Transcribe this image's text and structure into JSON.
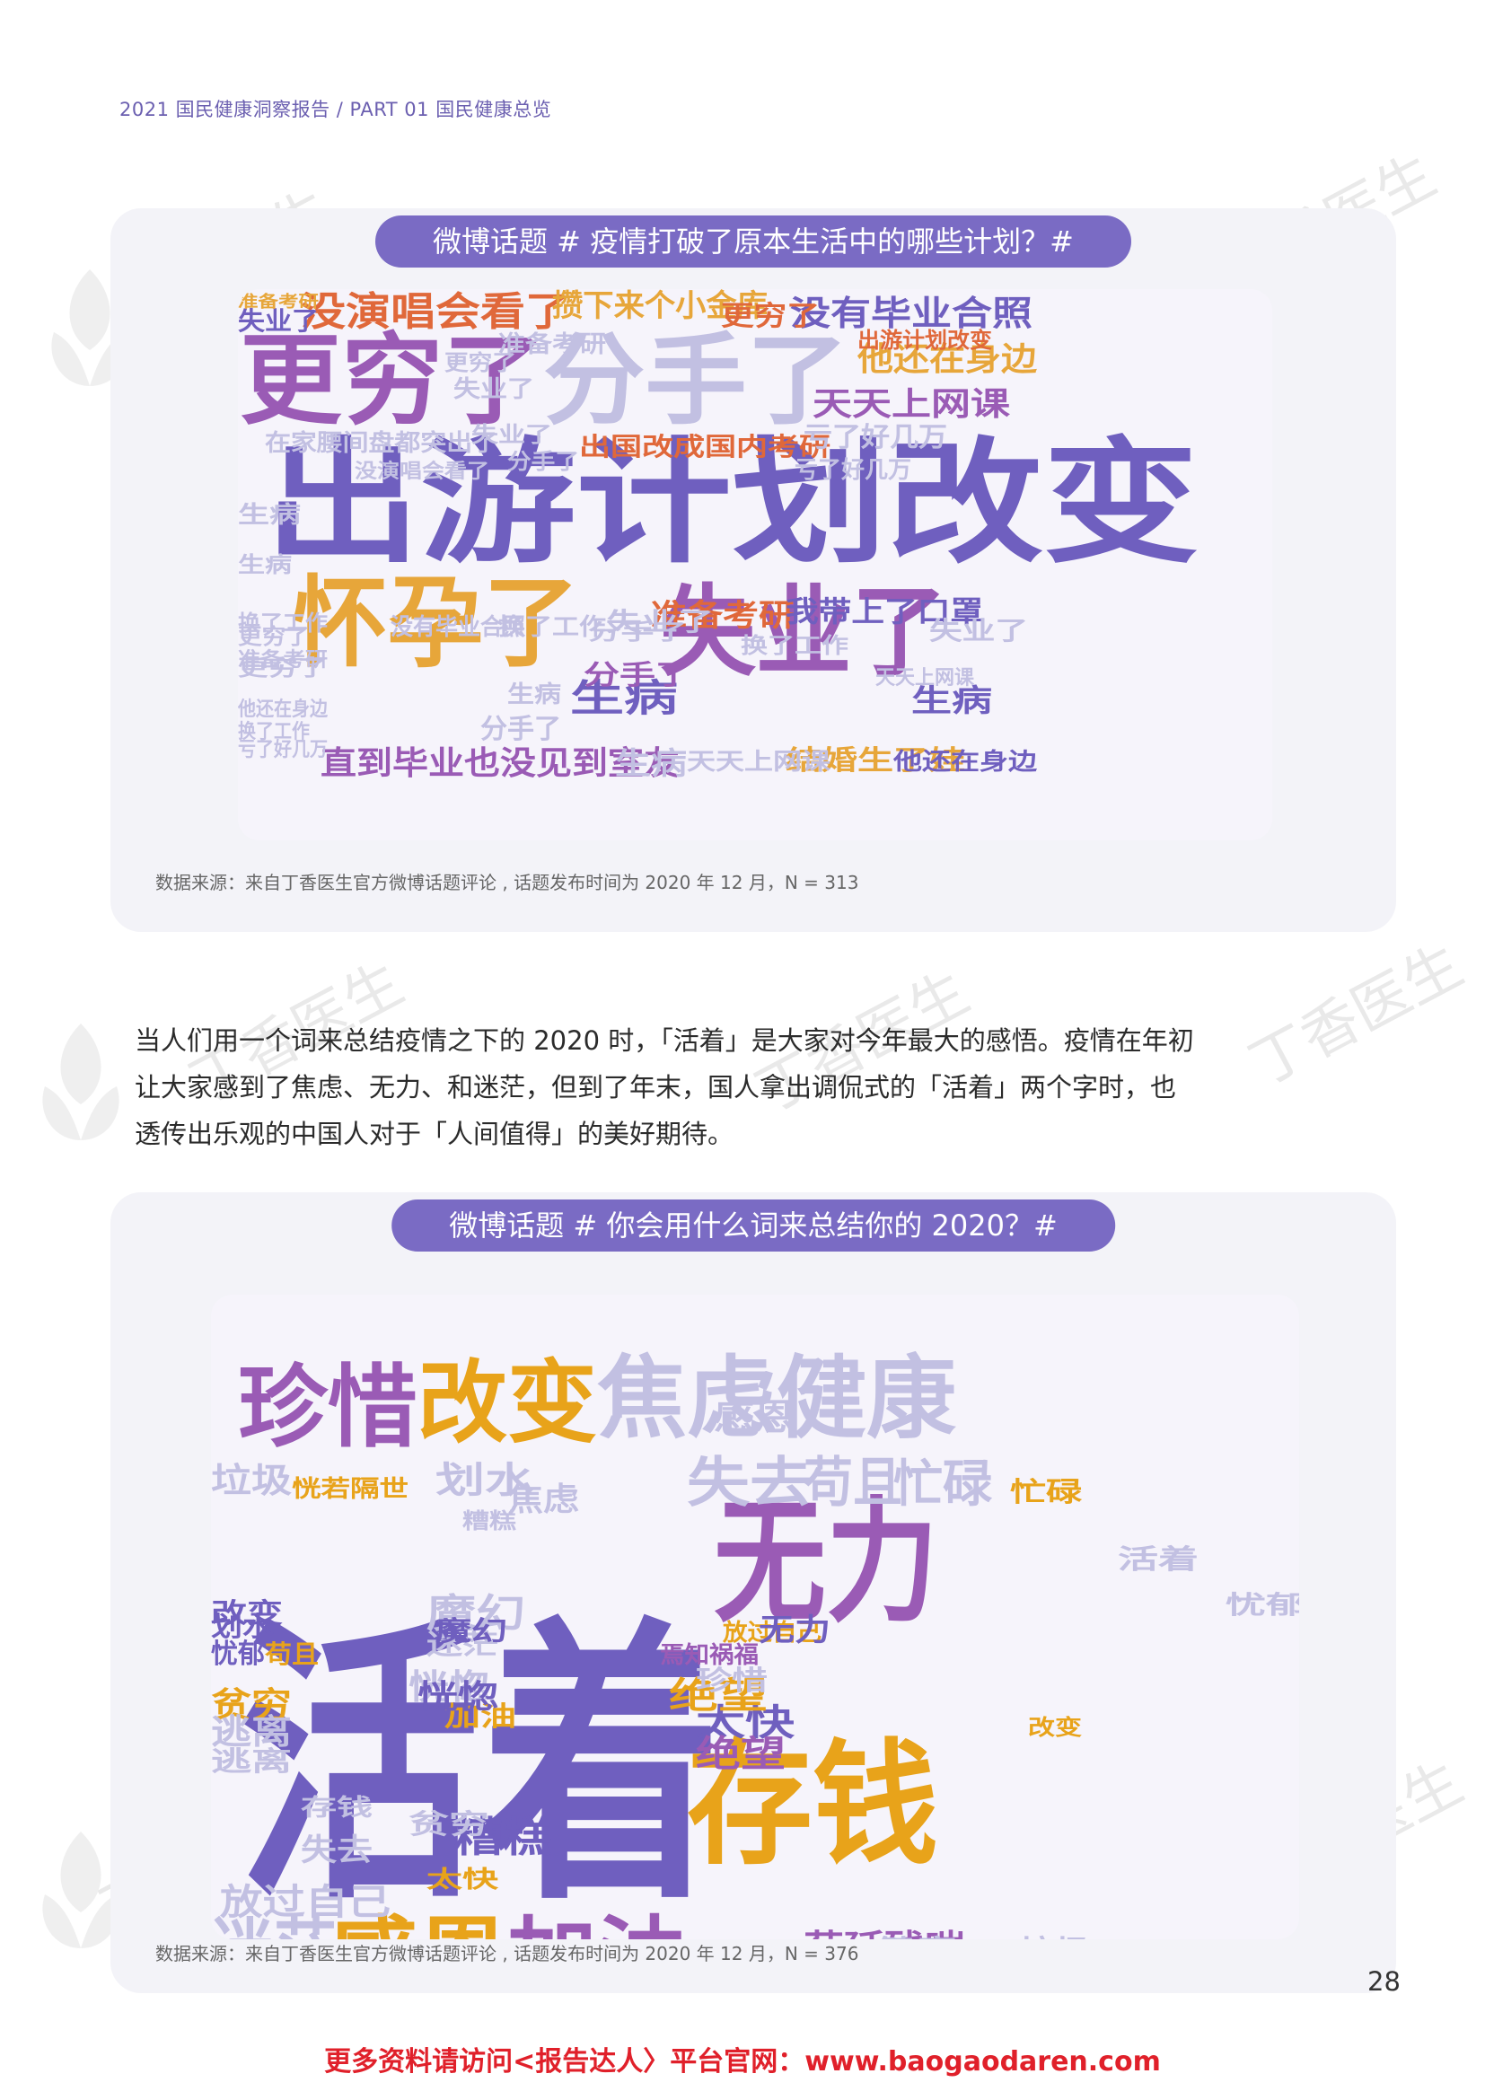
{
  "header": {
    "text": "2021 国民健康洞察报告 / PART 01 国民健康总览"
  },
  "watermark": {
    "text": "丁香医生",
    "color": "#e6e6e6"
  },
  "panel1": {
    "title": "微博话题 # 疫情打破了原本生活中的哪些计划？#",
    "source": "数据来源：来自丁香医生官方微博话题评论 , 话题发布时间为 2020 年 12 月，N = 313",
    "words": [
      {
        "text": "出游计划改变",
        "color": "#6f5fbf"
      },
      {
        "text": "更穷了",
        "color": "#9a5bb5"
      },
      {
        "text": "分手了",
        "color": "#c2c0e2"
      },
      {
        "text": "怀孕了",
        "color": "#e7a63a"
      },
      {
        "text": "失业了",
        "color": "#9a5bb5"
      },
      {
        "text": "没演唱会看了",
        "color": "#e0683a"
      },
      {
        "text": "攒下来个小金库",
        "color": "#e7a63a"
      },
      {
        "text": "没有毕业合照",
        "color": "#6f5fbf"
      },
      {
        "text": "他还在身边",
        "color": "#e7a63a"
      },
      {
        "text": "天天上网课",
        "color": "#9a5bb5"
      },
      {
        "text": "出游计划改变",
        "color": "#e0683a"
      },
      {
        "text": "出国改成国内考研",
        "color": "#e0683a"
      },
      {
        "text": "亏了好几万",
        "color": "#c2c0e2"
      },
      {
        "text": "直到毕业也没见到室友",
        "color": "#9a5bb5"
      },
      {
        "text": "生病",
        "color": "#6f5fbf"
      },
      {
        "text": "结婚生了娃",
        "color": "#e7a63a"
      },
      {
        "text": "准备考研",
        "color": "#e0683a"
      },
      {
        "text": "我带上了口罩",
        "color": "#6f5fbf"
      },
      {
        "text": "更穷了",
        "color": "#e0683a"
      },
      {
        "text": "失业了",
        "color": "#6f5fbf"
      },
      {
        "text": "准备考研",
        "color": "#e7a63a"
      },
      {
        "text": "分手了",
        "color": "#9a5bb5"
      },
      {
        "text": "天天上网课",
        "color": "#c2c0e2"
      },
      {
        "text": "他还在身边",
        "color": "#6f5fbf"
      },
      {
        "text": "生病",
        "color": "#c2c0e2"
      },
      {
        "text": "在家腰间盘都突出了",
        "color": "#c2c0e2"
      },
      {
        "text": "没演唱会看了",
        "color": "#c2c0e2"
      },
      {
        "text": "没有毕业合照",
        "color": "#c2c0e2"
      },
      {
        "text": "换了工作",
        "color": "#c2c0e2"
      },
      {
        "text": "生病",
        "color": "#c2c0e2"
      },
      {
        "text": "失业了",
        "color": "#c2c0e2"
      },
      {
        "text": "更穷了",
        "color": "#c2c0e2"
      },
      {
        "text": "准备考研",
        "color": "#c2c0e2"
      },
      {
        "text": "分手了",
        "color": "#c2c0e2"
      },
      {
        "text": "亏了好几万",
        "color": "#c2c0e2"
      },
      {
        "text": "换了工作",
        "color": "#c2c0e2"
      },
      {
        "text": "生病",
        "color": "#c2c0e2"
      },
      {
        "text": "分手了",
        "color": "#c2c0e2"
      },
      {
        "text": "失业了",
        "color": "#c2c0e2"
      },
      {
        "text": "生病",
        "color": "#c2c0e2"
      },
      {
        "text": "换了工作",
        "color": "#c2c0e2"
      },
      {
        "text": "失业了",
        "color": "#c2c0e2"
      },
      {
        "text": "生病",
        "color": "#6f5fbf"
      },
      {
        "text": "更穷了",
        "color": "#c2c0e2"
      },
      {
        "text": "天天上网课",
        "color": "#c2c0e2"
      },
      {
        "text": "更穷了",
        "color": "#c2c0e2"
      },
      {
        "text": "他还在身边",
        "color": "#c2c0e2"
      },
      {
        "text": "分手了",
        "color": "#c2c0e2"
      },
      {
        "text": "失业了",
        "color": "#c2c0e2"
      },
      {
        "text": "换了工作",
        "color": "#c2c0e2"
      },
      {
        "text": "准备考研",
        "color": "#c2c0e2"
      },
      {
        "text": "亏了好几万",
        "color": "#c2c0e2"
      }
    ]
  },
  "paragraph": {
    "lines": [
      "当人们用一个词来总结疫情之下的 2020 时，「活着」是大家对今年最大的感悟。疫情在年初",
      "让大家感到了焦虑、无力、和迷茫，但到了年末，国人拿出调侃式的「活着」两个字时，也",
      "透传出乐观的中国人对于「人间值得」的美好期待。"
    ]
  },
  "panel2": {
    "title": "微博话题 # 你会用什么词来总结你的 2020？#",
    "source": "数据来源：来自丁香医生官方微博话题评论 , 话题发布时间为 2020 年 12 月，N = 376",
    "words": [
      {
        "text": "活着",
        "color": "#6f5fbf"
      },
      {
        "text": "无力",
        "color": "#9a5bb5"
      },
      {
        "text": "存钱",
        "color": "#e8a31a"
      },
      {
        "text": "珍惜",
        "color": "#9a5bb5"
      },
      {
        "text": "改变",
        "color": "#e8a31a"
      },
      {
        "text": "焦虑",
        "color": "#c2c0e2"
      },
      {
        "text": "健康",
        "color": "#c2c0e2"
      },
      {
        "text": "感恩",
        "color": "#e8a31a"
      },
      {
        "text": "加油",
        "color": "#9a5bb5"
      },
      {
        "text": "迷茫",
        "color": "#c2c0e2"
      },
      {
        "text": "失去",
        "color": "#c2c0e2"
      },
      {
        "text": "苟且",
        "color": "#c2c0e2"
      },
      {
        "text": "忙碌",
        "color": "#c2c0e2"
      },
      {
        "text": "糟糕",
        "color": "#6f5fbf"
      },
      {
        "text": "太快",
        "color": "#6f5fbf"
      },
      {
        "text": "绝望",
        "color": "#e8a31a"
      },
      {
        "text": "苟延残喘",
        "color": "#9a5bb5"
      },
      {
        "text": "焉知祸福",
        "color": "#c2c0e2"
      },
      {
        "text": "放过自己",
        "color": "#c2c0e2"
      },
      {
        "text": "魔幻",
        "color": "#c2c0e2"
      },
      {
        "text": "划水",
        "color": "#c2c0e2"
      },
      {
        "text": "贫穷",
        "color": "#e8a31a"
      },
      {
        "text": "恍惚",
        "color": "#c2c0e2"
      },
      {
        "text": "逃离",
        "color": "#c2c0e2"
      },
      {
        "text": "垃圾",
        "color": "#c2c0e2"
      },
      {
        "text": "恍若隔世",
        "color": "#e8a31a"
      },
      {
        "text": "忧郁",
        "color": "#c2c0e2"
      },
      {
        "text": "改变",
        "color": "#6f5fbf"
      },
      {
        "text": "放过自己",
        "color": "#e8a31a"
      },
      {
        "text": "焉知祸福",
        "color": "#9a5bb5"
      },
      {
        "text": "苟且",
        "color": "#e8a31a"
      },
      {
        "text": "感恩",
        "color": "#c2c0e2"
      },
      {
        "text": "迷茫",
        "color": "#c2c0e2"
      },
      {
        "text": "加油",
        "color": "#e8a31a"
      },
      {
        "text": "恍惚",
        "color": "#6f5fbf"
      },
      {
        "text": "无力",
        "color": "#6f5fbf"
      },
      {
        "text": "珍惜",
        "color": "#c2c0e2"
      },
      {
        "text": "存钱",
        "color": "#c2c0e2"
      },
      {
        "text": "活着",
        "color": "#c2c0e2"
      },
      {
        "text": "健康",
        "color": "#c2c0e2"
      },
      {
        "text": "贫穷",
        "color": "#c2c0e2"
      },
      {
        "text": "垃圾",
        "color": "#c2c0e2"
      },
      {
        "text": "焦虑",
        "color": "#c2c0e2"
      },
      {
        "text": "魔幻",
        "color": "#6f5fbf"
      },
      {
        "text": "太快",
        "color": "#e8a31a"
      },
      {
        "text": "划水",
        "color": "#6f5fbf"
      },
      {
        "text": "逃离",
        "color": "#c2c0e2"
      },
      {
        "text": "绝望",
        "color": "#9a5bb5"
      },
      {
        "text": "失去",
        "color": "#c2c0e2"
      },
      {
        "text": "忙碌",
        "color": "#e8a31a"
      },
      {
        "text": "糟糕",
        "color": "#c2c0e2"
      },
      {
        "text": "改变",
        "color": "#e8a31a"
      },
      {
        "text": "忧郁",
        "color": "#6f5fbf"
      }
    ]
  },
  "page_number": "28",
  "footer": {
    "text": "更多资料请访问<报告达人〉平台官网：www.baogaodaren.com"
  }
}
